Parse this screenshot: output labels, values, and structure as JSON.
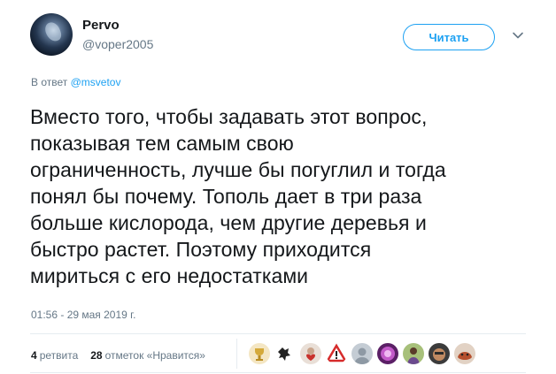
{
  "tweet": {
    "display_name": "Pervo",
    "username": "@voper2005",
    "follow_label": "Читать",
    "reply_prefix": "В ответ",
    "reply_handle": "@msvetov",
    "text_lines": [
      "Вместо того, чтобы задавать этот вопрос,",
      "показывая тем самым свою",
      "ограниченность, лучше бы погуглил и тогда",
      "понял бы почему. Тополь дает в три раза",
      "больше кислорода, чем другие деревья и",
      "быстро растет. Поэтому приходится",
      "мириться с его недостатками"
    ],
    "timestamp": "01:56 - 29 мая 2019 г."
  },
  "stats": {
    "retweets_count": "4",
    "retweets_label": "ретвита",
    "likes_count": "28",
    "likes_label": "отметок «Нравится»"
  },
  "likers": [
    {
      "icon": "trophy-avatar-icon",
      "color": "#d4a93a"
    },
    {
      "icon": "silhouette-avatar-icon",
      "color": "#222222"
    },
    {
      "icon": "heart-avatar-icon",
      "color": "#c8322d"
    },
    {
      "icon": "warning-triangle-avatar-icon",
      "color": "#d62b2b"
    },
    {
      "icon": "default-egg-avatar-icon",
      "color": "#9aa5b1"
    },
    {
      "icon": "pink-flower-avatar-icon",
      "color": "#a63fa8"
    },
    {
      "icon": "person-avatar-icon",
      "color": "#6b8e3a"
    },
    {
      "icon": "face-avatar-icon",
      "color": "#8a5a3c"
    },
    {
      "icon": "animal-avatar-icon",
      "color": "#b5502e"
    }
  ],
  "colors": {
    "accent": "#1da1f2",
    "secondary_text": "#657786",
    "primary_text": "#14171a"
  }
}
